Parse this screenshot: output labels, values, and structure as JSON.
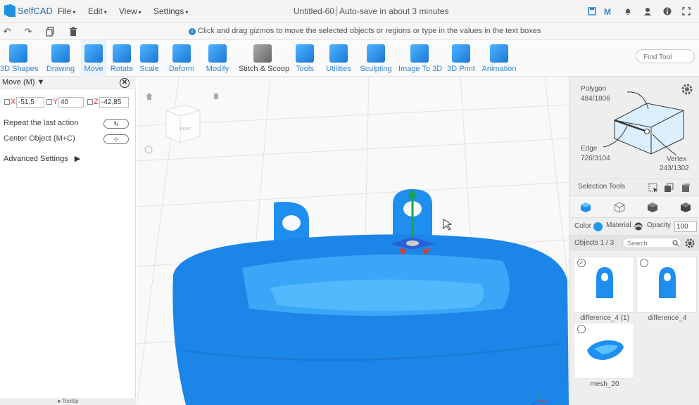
{
  "app": {
    "name": "SelfCAD",
    "title": "Untitled-60",
    "autosave": "Auto-save in about 3 minutes"
  },
  "menus": [
    "File",
    "Edit",
    "View",
    "Settings"
  ],
  "hint": "Click and drag gizmos to move the selected objects or regions or type in the values in the text boxes",
  "tools": [
    {
      "label": "3D Shapes",
      "icon": "cube-icon"
    },
    {
      "label": "Drawing",
      "icon": "drawing-icon"
    },
    {
      "label": "Move",
      "icon": "move-icon"
    },
    {
      "label": "Rotate",
      "icon": "rotate-icon"
    },
    {
      "label": "Scale",
      "icon": "scale-icon"
    },
    {
      "label": "Deform",
      "icon": "deform-icon"
    },
    {
      "label": "Modify",
      "icon": "modify-icon"
    },
    {
      "label": "Stitch & Scoop",
      "icon": "stitch-scoop-icon"
    },
    {
      "label": "Tools",
      "icon": "tools-icon"
    },
    {
      "label": "Utilities",
      "icon": "utilities-icon"
    },
    {
      "label": "Sculpting",
      "icon": "sculpting-icon"
    },
    {
      "label": "Image To 3D",
      "icon": "image-to-3d-icon"
    },
    {
      "label": "3D Print",
      "icon": "3d-print-icon"
    },
    {
      "label": "Animation",
      "icon": "animation-icon"
    }
  ],
  "find_tool": {
    "placeholder": "Find Tool"
  },
  "move_panel": {
    "title": "Move (M)",
    "x_label": "X",
    "x_value": "-51,5",
    "y_label": "Y",
    "y_value": "40",
    "z_label": "Z",
    "z_value": "-42,85",
    "repeat_label": "Repeat the last action",
    "center_label": "Center Object (M+C)",
    "advanced_label": "Advanced Settings",
    "tooltip_label": "Tooltip"
  },
  "selection_info": {
    "polygon_label": "Polygon",
    "polygon_count": "484/1806",
    "edge_label": "Edge",
    "edge_count": "726/3104",
    "vertex_label": "Vertex",
    "vertex_count": "243/1302"
  },
  "selection_tools_label": "Selection Tools",
  "color_row": {
    "color_label": "Color",
    "color_value": "#1e9be8",
    "material_label": "Material",
    "opacity_label": "Opacity",
    "opacity_value": "100"
  },
  "objects": {
    "header": "Objects 1 / 3",
    "search_placeholder": "Search",
    "items": [
      {
        "name": "difference_4 (1)",
        "checked": true
      },
      {
        "name": "difference_4",
        "checked": false
      },
      {
        "name": "mesh_20",
        "checked": false
      }
    ]
  },
  "viewcube_face": "RIGHT",
  "colors": {
    "accent": "#2f86d6",
    "model": "#1e8ef0"
  }
}
